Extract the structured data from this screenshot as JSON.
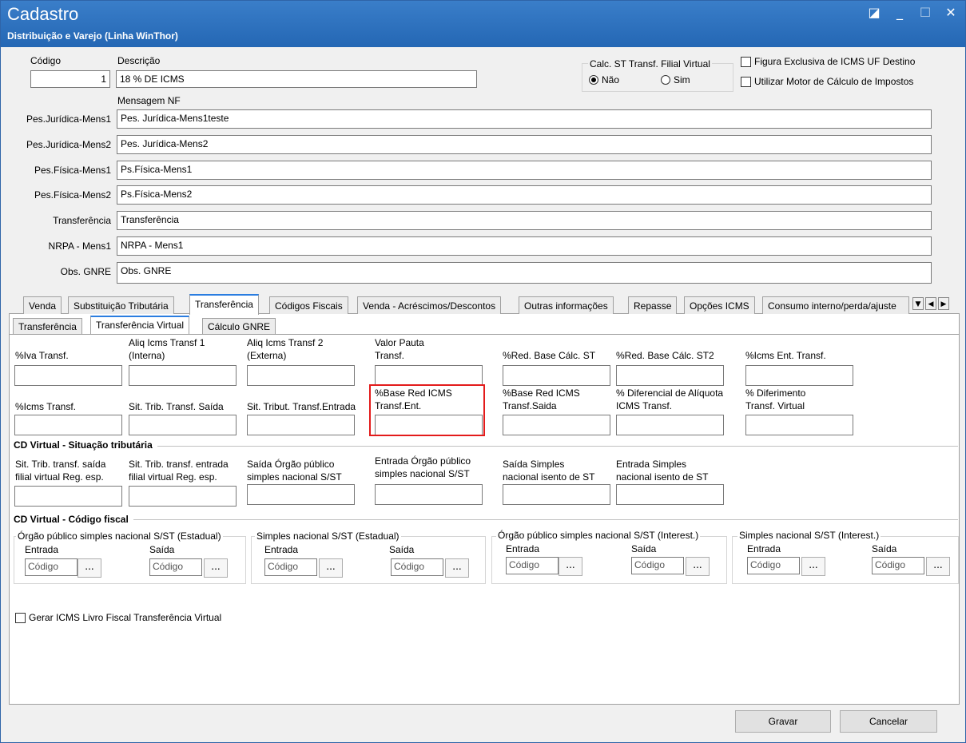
{
  "window": {
    "title": "Cadastro",
    "subtitle": "Distribuição e Varejo (Linha WinThor)",
    "controls": [
      "restore-icon",
      "minimize-icon",
      "maximize-icon",
      "close-icon"
    ]
  },
  "header": {
    "codigo_label": "Código",
    "codigo_value": "1",
    "descricao_label": "Descrição",
    "descricao_value": "18 % DE ICMS",
    "mensagem_nf_label": "Mensagem NF",
    "calc_st_group": "Calc. ST Transf. Filial Virtual",
    "radio_nao": "Não",
    "radio_sim": "Sim",
    "chk_figura": "Figura Exclusiva de ICMS UF Destino",
    "chk_motor": "Utilizar Motor de Cálculo de Impostos"
  },
  "messages": [
    {
      "label": "Pes.Jurídica-Mens1",
      "value": "Pes. Jurídica-Mens1teste"
    },
    {
      "label": "Pes.Jurídica-Mens2",
      "value": "Pes. Jurídica-Mens2"
    },
    {
      "label": "Pes.Física-Mens1",
      "value": "Ps.Física-Mens1"
    },
    {
      "label": "Pes.Física-Mens2",
      "value": "Ps.Física-Mens2"
    },
    {
      "label": "Transferência",
      "value": "Transferência"
    },
    {
      "label": "NRPA - Mens1",
      "value": "NRPA - Mens1"
    },
    {
      "label": "Obs. GNRE",
      "value": "Obs. GNRE"
    }
  ],
  "main_tabs": [
    "Venda",
    "Substituição Tributária",
    "Transferência",
    "Códigos Fiscais",
    "Venda - Acréscimos/Descontos",
    "Outras informações",
    "Repasse",
    "Opções ICMS",
    "Consumo interno/perda/ajuste"
  ],
  "sub_tabs": [
    "Transferência",
    "Transferência Virtual",
    "Cálculo GNRE"
  ],
  "row1": [
    {
      "l1": "",
      "l2": "%Iva Transf."
    },
    {
      "l1": "Aliq Icms Transf 1",
      "l2": "(Interna)"
    },
    {
      "l1": "Aliq Icms Transf 2",
      "l2": "(Externa)"
    },
    {
      "l1": "Valor Pauta",
      "l2": "Transf."
    },
    {
      "l1": "",
      "l2": "%Red. Base Cálc. ST"
    },
    {
      "l1": "",
      "l2": "%Red. Base Cálc. ST2"
    },
    {
      "l1": "",
      "l2": "%Icms Ent. Transf."
    }
  ],
  "row2": [
    {
      "l1": "",
      "l2": "%Icms Transf."
    },
    {
      "l1": "",
      "l2": "Sit. Trib. Transf. Saída"
    },
    {
      "l1": "",
      "l2": "Sit. Tribut. Transf.Entrada"
    },
    {
      "l1": "%Base Red ICMS",
      "l2": "Transf.Ent."
    },
    {
      "l1": "%Base Red ICMS",
      "l2": "Transf.Saida"
    },
    {
      "l1": "% Diferencial de Alíquota",
      "l2": "ICMS Transf."
    },
    {
      "l1": "% Diferimento",
      "l2": "Transf. Virtual"
    }
  ],
  "section_sit": "CD Virtual - Situação tributária",
  "row3": [
    {
      "l1": "Sit. Trib. transf. saída",
      "l2": "filial virtual Reg. esp."
    },
    {
      "l1": "Sit. Trib. transf. entrada",
      "l2": "filial virtual Reg. esp."
    },
    {
      "l1": "Saída Órgão público",
      "l2": "simples nacional S/ST"
    },
    {
      "l1": "Entrada Órgão público",
      "l2": "simples nacional S/ST"
    },
    {
      "l1": "Saída Simples",
      "l2": "nacional isento de ST"
    },
    {
      "l1": "Entrada Simples",
      "l2": "nacional isento de ST"
    }
  ],
  "section_cfop": "CD Virtual - Código fiscal",
  "cfop_groups": [
    {
      "title": "Órgão público simples nacional S/ST (Estadual)",
      "entrada": "Entrada",
      "saida": "Saída",
      "placeholder": "Código",
      "btn": "..."
    },
    {
      "title": "Simples nacional S/ST (Estadual)",
      "entrada": "Entrada",
      "saida": "Saída",
      "placeholder": "Código",
      "btn": "..."
    },
    {
      "title": "Órgão público simples nacional S/ST (Interest.)",
      "entrada": "Entrada",
      "saida": "Saída",
      "placeholder": "Código",
      "btn": "..."
    },
    {
      "title": "Simples nacional S/ST (Interest.)",
      "entrada": "Entrada",
      "saida": "Saída",
      "placeholder": "Código",
      "btn": "..."
    }
  ],
  "chk_gerar": "Gerar ICMS Livro Fiscal Transferência Virtual",
  "buttons": {
    "save": "Gravar",
    "cancel": "Cancelar"
  },
  "colors": {
    "titlebar": "#2467b4",
    "active_tab": "#2a7de0",
    "highlight": "#e31b1b"
  }
}
